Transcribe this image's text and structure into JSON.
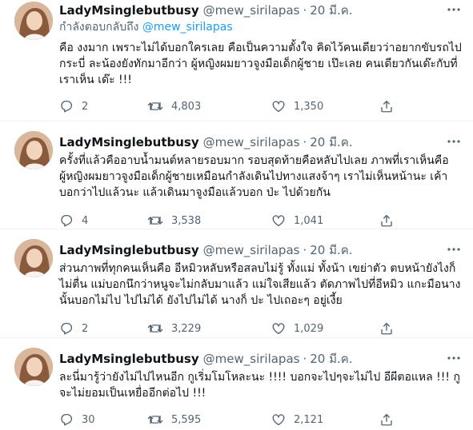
{
  "colors": {
    "accent": "#1d9bf0",
    "muted": "#536471",
    "text": "#0f1419",
    "divider": "#eff3f4"
  },
  "icons": {
    "more": "more-horizontal-icon",
    "reply": "reply-icon",
    "retweet": "retweet-icon",
    "like": "heart-icon",
    "share": "share-icon"
  },
  "tweets": [
    {
      "name": "LadyMsinglebutbusy",
      "handle": "@mew_sirilapas",
      "dot": "·",
      "date": "20 มี.ค.",
      "reply_to_prefix": "กำลังตอบกลับถึง",
      "reply_to_handle": "@mew_sirilapas",
      "text": "คือ งงมาก เพราะไม่ได้บอกใครเลย คือเป็นความตั้งใจ คิดไว้คนเดียวว่าอยากขับรถไป\nกระบี่ ละน้องยังทักมาอีกว่า ผู้หญิงผมยาวจูงมือเด็กผู้ชาย เป๊ะเลย คนเดียวกันเด๊ะกับที่\nเราเห็น เด๊ะ !!!",
      "replies": "2",
      "retweets": "4,803",
      "likes": "1,350"
    },
    {
      "name": "LadyMsinglebutbusy",
      "handle": "@mew_sirilapas",
      "dot": "·",
      "date": "20 มี.ค.",
      "text": "ครั้งที่แล้วคืออาบน้ำมนต์หลายรอบมาก รอบสุดท้ายคือหลับไปเลย ภาพที่เราเห็นคือ\nผู้หญิงผมยาวจูงมือเด็กผู้ชายเหมือนกำลังเดินไปทางแสงจ้าๆ เราไม่เห็นหน้านะ เค้า\nบอกว่าไปแล้วนะ แล้วเดินมาจูงมือแล้วบอก ป่ะ ไปด้วยกัน",
      "replies": "4",
      "retweets": "3,538",
      "likes": "1,041"
    },
    {
      "name": "LadyMsinglebutbusy",
      "handle": "@mew_sirilapas",
      "dot": "·",
      "date": "20 มี.ค.",
      "text": "ส่วนภาพที่ทุกคนเห็นคือ อีหมิวหลับหรือสลบไม่รู้ ทั้งแม่ ทั้งน้า เขย่าตัว ตบหน้ายังไงก็\nไม่ตื่น แม่บอกนึกว่าหนูจะไม่กลับมาแล้ว แม่ใจเสียแล้ว ตัดภาพไปที่อีหมิว แกะมือนาง\nนั้นบอกไม่ไป ไปไม่ได้ ยังไปไม่ได้ นางก็ ปะ ไปเถอะๆ อยู่เงี้ย",
      "replies": "2",
      "retweets": "3,229",
      "likes": "1,029"
    },
    {
      "name": "LadyMsinglebutbusy",
      "handle": "@mew_sirilapas",
      "dot": "·",
      "date": "20 มี.ค.",
      "text": "ละนี่มารู้ว่ายังไม่ไปไหนอีก กูเริ่มโมโหละนะ !!!! บอกจะไปๆจะไม่ไป อีผีตอแหล !!! กู\nจะไม่ยอมเป็นเหยื่ออีกต่อไป !!!",
      "replies": "30",
      "retweets": "5,595",
      "likes": "2,121"
    }
  ]
}
